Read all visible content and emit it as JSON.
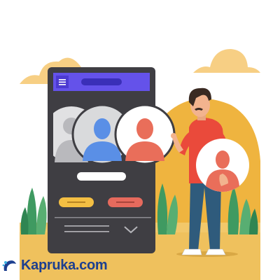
{
  "brand": {
    "watermark_text": "Kapruka.com"
  },
  "colors": {
    "background": "#ffffff",
    "ground": "#efc15d",
    "sun_hill": "#efb43f",
    "cloud": "#f7cf84",
    "phone_body": "#3f3e43",
    "phone_header": "#6452ea",
    "avatar_left": "#b9b9bd",
    "avatar_middle": "#5a8fe6",
    "avatar_right": "#e96e5a",
    "pill_yellow": "#f4bf43",
    "pill_red": "#e66a5d",
    "plant_green": "#3f9a61",
    "shirt": "#ea4a3b",
    "jeans": "#2f5b7c",
    "hair": "#3a2a22",
    "skin": "#f2b38e"
  },
  "icons": [
    "menu-icon",
    "chevron-down-icon",
    "user-avatar-icon"
  ]
}
